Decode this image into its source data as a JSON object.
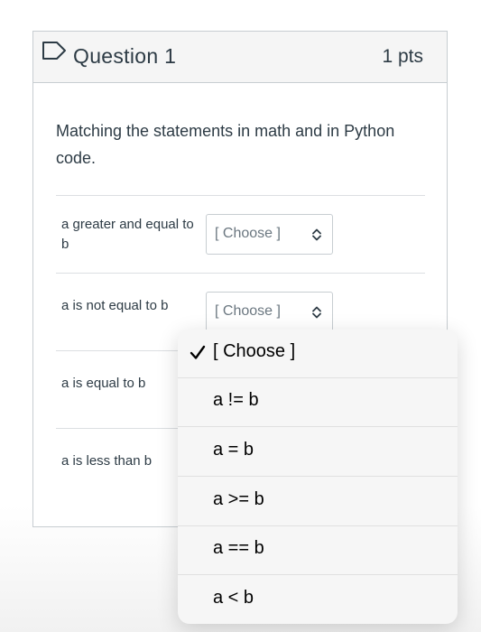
{
  "question": {
    "title": "Question 1",
    "points": "1 pts",
    "text": "Matching the statements in math and in Python code."
  },
  "rows": [
    {
      "label": "a greater and equal to b",
      "selected": "[ Choose ]"
    },
    {
      "label": "a is not equal to b",
      "selected": "[ Choose ]"
    },
    {
      "label": "a is equal to b"
    },
    {
      "label": "a is less than b"
    }
  ],
  "dropdown": {
    "options": [
      {
        "label": "[ Choose ]",
        "checked": true
      },
      {
        "label": "a != b"
      },
      {
        "label": "a = b"
      },
      {
        "label": "a >= b"
      },
      {
        "label": "a == b"
      },
      {
        "label": "a < b"
      }
    ]
  },
  "icons": {
    "flag": "flag-outline-icon",
    "select_arrows": "chevron-updown-icon",
    "check": "checkmark-icon"
  },
  "colors": {
    "text": "#2d3b45",
    "border": "#c7cdd1",
    "header_bg": "#f5f5f5",
    "menu_bg": "#f6f6f6"
  }
}
